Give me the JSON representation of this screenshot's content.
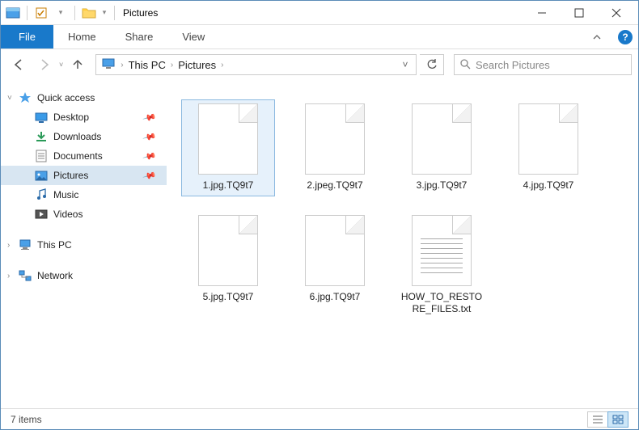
{
  "window": {
    "title": "Pictures"
  },
  "ribbon": {
    "file": "File",
    "tabs": [
      "Home",
      "Share",
      "View"
    ]
  },
  "breadcrumb": {
    "root_chevron": "›",
    "items": [
      "This PC",
      "Pictures"
    ]
  },
  "search": {
    "placeholder": "Search Pictures"
  },
  "sidebar": {
    "quick_access": "Quick access",
    "pinned": [
      {
        "label": "Desktop",
        "icon": "desktop"
      },
      {
        "label": "Downloads",
        "icon": "downloads"
      },
      {
        "label": "Documents",
        "icon": "documents"
      },
      {
        "label": "Pictures",
        "icon": "pictures",
        "selected": true
      }
    ],
    "recent": [
      {
        "label": "Music",
        "icon": "music"
      },
      {
        "label": "Videos",
        "icon": "videos"
      }
    ],
    "this_pc": "This PC",
    "network": "Network"
  },
  "files": [
    {
      "name": "1.jpg.TQ9t7",
      "type": "blank",
      "selected": true
    },
    {
      "name": "2.jpeg.TQ9t7",
      "type": "blank"
    },
    {
      "name": "3.jpg.TQ9t7",
      "type": "blank"
    },
    {
      "name": "4.jpg.TQ9t7",
      "type": "blank"
    },
    {
      "name": "5.jpg.TQ9t7",
      "type": "blank"
    },
    {
      "name": "6.jpg.TQ9t7",
      "type": "blank"
    },
    {
      "name": "HOW_TO_RESTORE_FILES.txt",
      "type": "txt"
    }
  ],
  "status": {
    "count_label": "7 items"
  }
}
